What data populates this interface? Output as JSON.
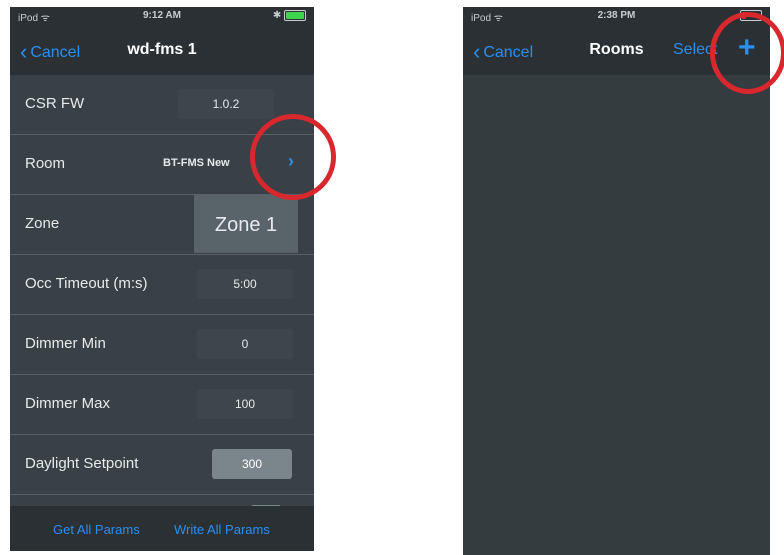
{
  "left_screen": {
    "status": {
      "carrier": "iPod ᯤ",
      "time": "9:12 AM",
      "right": "✱"
    },
    "nav": {
      "back_label": "Cancel",
      "title": "wd-fms 1"
    },
    "rows": [
      {
        "label": "CSR FW",
        "value": "1.0.2"
      },
      {
        "label": "Room",
        "value": "BT-FMS New",
        "disclosure": "›"
      },
      {
        "label": "Zone",
        "value": "Zone 1"
      },
      {
        "label": "Occ Timeout (m:s)",
        "value": "5:00"
      },
      {
        "label": "Dimmer Min",
        "value": "0"
      },
      {
        "label": "Dimmer Max",
        "value": "100"
      },
      {
        "label": "Daylight Setpoint",
        "value": "300"
      }
    ],
    "toolbar": {
      "get_all": "Get All Params",
      "write_all": "Write All Params"
    }
  },
  "right_screen": {
    "status": {
      "carrier": "iPod ᯤ",
      "time": "2:38 PM"
    },
    "nav": {
      "back_label": "Cancel",
      "title": "Rooms",
      "select_label": "Select",
      "add_label": "+"
    }
  },
  "colors": {
    "accent": "#2b8ff0",
    "highlight_circle": "#d9282d",
    "battery_left": "#3ed44b",
    "battery_right": "#d9282d"
  }
}
